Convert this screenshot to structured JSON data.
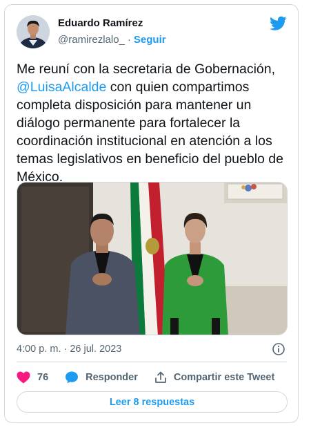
{
  "author": {
    "name": "Eduardo Ramírez",
    "handle": "@ramirezlalo_",
    "separator": "·",
    "follow_label": "Seguir"
  },
  "tweet": {
    "text_before": "Me reuní con la secretaria de Gobernación, ",
    "mention": "@LuisaAlcalde",
    "text_after": " con quien compartimos completa disposición para mantener un diálogo permanente para fortalecer la coordinación institucional en atención a los temas legislativos en beneficio del pueblo de México.",
    "timestamp": "4:00 p. m. · 26 jul. 2023"
  },
  "actions": {
    "likes_count": "76",
    "reply_label": "Responder",
    "share_label": "Compartir este Tweet"
  },
  "replies_button_label": "Leer 8 respuestas",
  "colors": {
    "accent": "#1d9bf0",
    "like": "#f91880",
    "muted": "#536471"
  },
  "icons": [
    "twitter-bird-icon",
    "info-icon",
    "heart-icon",
    "reply-bubble-icon",
    "share-icon"
  ]
}
